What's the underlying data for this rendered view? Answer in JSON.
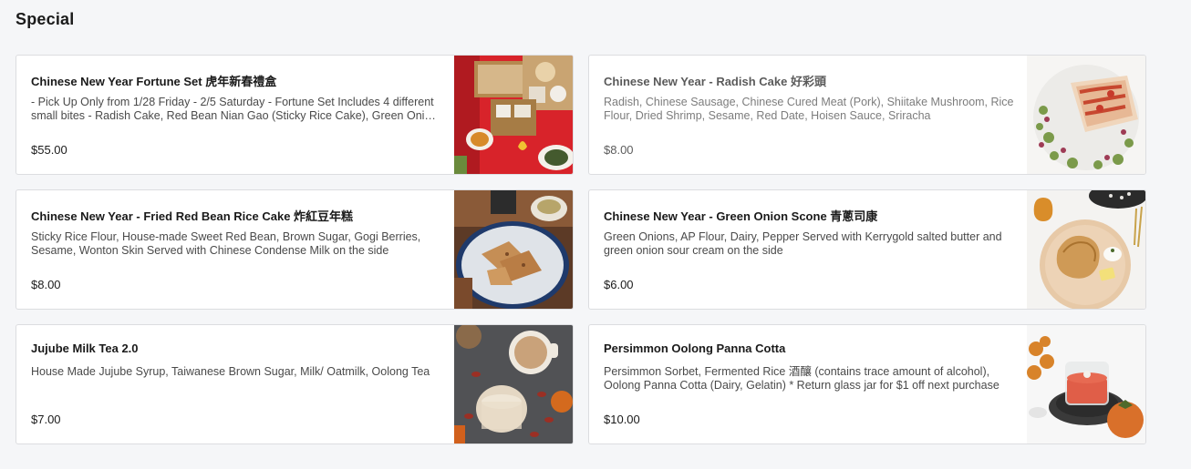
{
  "section": {
    "title": "Special"
  },
  "items": [
    {
      "name": "Chinese New Year Fortune Set 虎年新春禮盒",
      "description": "- Pick Up Only from 1/28 Friday - 2/5 Saturday - Fortune Set Includes 4 different small bites - Radish Cake, Red Bean Nian Gao (Sticky Rice Cake), Green Onion Scone, and Jujube Milk Tea",
      "price": "$55.00",
      "image": "fortune-set-photo"
    },
    {
      "name": "Chinese New Year - Radish Cake 好彩頭",
      "description": "Radish, Chinese Sausage, Chinese Cured Meat (Pork), Shiitake Mushroom, Rice Flour, Dried Shrimp, Sesame, Red Date, Hoisen Sauce, Sriracha",
      "price": "$8.00",
      "image": "radish-cake-photo"
    },
    {
      "name": "Chinese New Year - Fried Red Bean Rice Cake 炸紅豆年糕",
      "description": "Sticky Rice Flour, House-made Sweet Red Bean, Brown Sugar, Gogi Berries, Sesame, Wonton Skin Served with Chinese Condense Milk on the side",
      "price": "$8.00",
      "image": "rice-cake-photo"
    },
    {
      "name": "Chinese New Year - Green Onion Scone 青蔥司康",
      "description": "Green Onions, AP Flour, Dairy, Pepper Served with Kerrygold salted butter and green onion sour cream on the side",
      "price": "$6.00",
      "image": "scone-photo"
    },
    {
      "name": "Jujube Milk Tea 2.0",
      "description": "House Made Jujube Syrup, Taiwanese Brown Sugar, Milk/ Oatmilk, Oolong Tea",
      "price": "$7.00",
      "image": "milk-tea-photo"
    },
    {
      "name": "Persimmon Oolong Panna Cotta",
      "description": "Persimmon Sorbet, Fermented Rice 酒釀 (contains trace amount of alcohol), Oolong Panna Cotta (Dairy, Gelatin) * Return glass jar for $1 off next purchase",
      "price": "$10.00",
      "image": "panna-cotta-photo"
    }
  ]
}
